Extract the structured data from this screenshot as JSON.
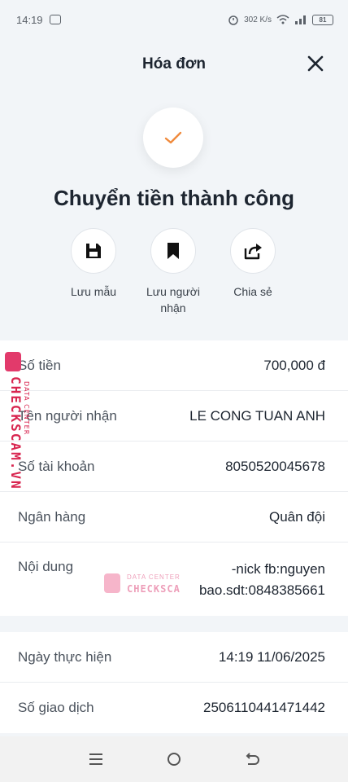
{
  "status_bar": {
    "time": "14:19",
    "network_speed": "302 K/s",
    "battery": "81"
  },
  "header": {
    "title": "Hóa đơn"
  },
  "success": {
    "title": "Chuyển tiền thành công",
    "check_color": "#f08a3c"
  },
  "actions": [
    {
      "label": "Lưu mẫu",
      "icon": "floppy-disk-icon"
    },
    {
      "label": "Lưu người nhận",
      "icon": "bookmark-icon"
    },
    {
      "label": "Chia sẻ",
      "icon": "share-icon"
    }
  ],
  "details": {
    "amount_label": "Số tiền",
    "amount_value": "700,000 đ",
    "recipient_label": "Tên người nhận",
    "recipient_value": "LE CONG TUAN ANH",
    "account_label": "Số tài khoản",
    "account_value": "8050520045678",
    "bank_label": "Ngân hàng",
    "bank_value": "Quân đội",
    "content_label": "Nội dung",
    "content_line1": "-nick fb:nguyen",
    "content_line2": "bao.sdt:0848385661"
  },
  "transaction": {
    "date_label": "Ngày thực hiện",
    "date_value": "14:19 11/06/2025",
    "id_label": "Số giao dịch",
    "id_value": "2506110441471442"
  },
  "watermark": {
    "brand": "CHECKSCAM.VN",
    "tag": "DATA CENTER",
    "brand_short": "CHECKSCA"
  }
}
